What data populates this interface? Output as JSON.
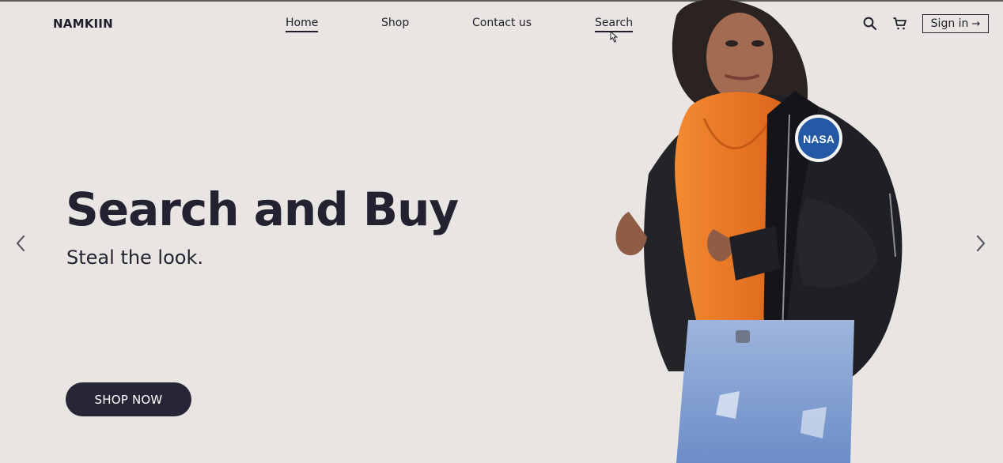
{
  "brand": {
    "name": "NAMKIIN"
  },
  "nav": {
    "items": [
      {
        "label": "Home"
      },
      {
        "label": "Shop"
      },
      {
        "label": "Contact us"
      },
      {
        "label": "Search"
      }
    ]
  },
  "header": {
    "signin_label": "Sign in",
    "signin_arrow": "→"
  },
  "hero": {
    "title": "Search and Buy",
    "subtitle": "Steal the look.",
    "cta_label": "SHOP NOW"
  },
  "icons": {
    "search": "search-icon",
    "cart": "cart-icon",
    "prev": "chevron-left-icon",
    "next": "chevron-right-icon"
  },
  "colors": {
    "background": "#e9e5e3",
    "text": "#1f1f2b",
    "button": "#262637",
    "button_text": "#ffffff",
    "hoodie": "#ef7a1d",
    "jacket": "#222327",
    "jeans": "#7c9ed3"
  }
}
